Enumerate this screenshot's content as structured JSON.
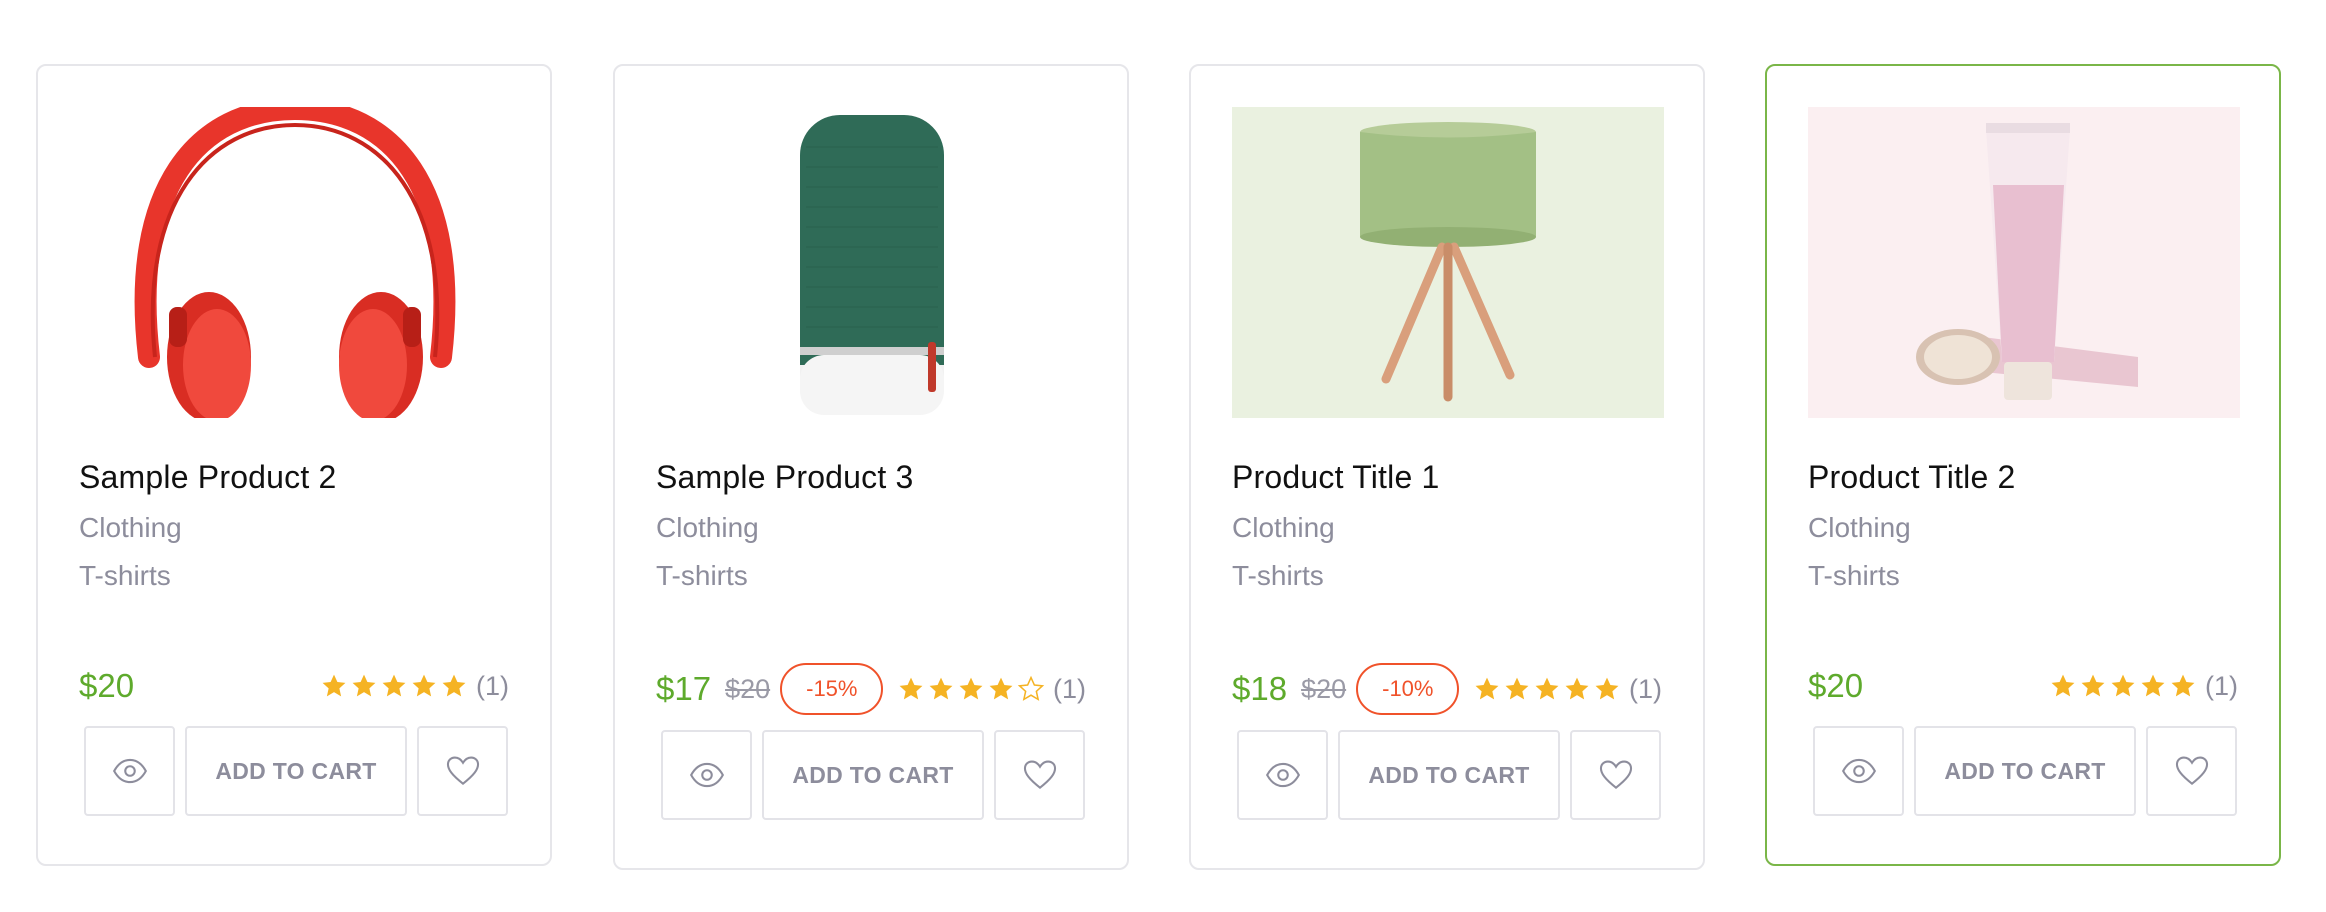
{
  "products": [
    {
      "title": "Sample Product 2",
      "categories": [
        "Clothing",
        "T-shirts"
      ],
      "price": "$20",
      "old_price": "",
      "discount": "",
      "rating": 5,
      "rating_count": "(1)",
      "image_icon": "headphones-image",
      "actions": {
        "quick_view_icon": "eye-icon",
        "cart_label": "ADD TO CART",
        "wishlist_icon": "heart-icon"
      }
    },
    {
      "title": "Sample Product 3",
      "categories": [
        "Clothing",
        "T-shirts"
      ],
      "price": "$17",
      "old_price": "$20",
      "discount": "-15%",
      "rating": 4,
      "rating_count": "(1)",
      "image_icon": "speaker-image",
      "actions": {
        "quick_view_icon": "eye-icon",
        "cart_label": "ADD TO CART",
        "wishlist_icon": "heart-icon"
      }
    },
    {
      "title": "Product Title 1",
      "categories": [
        "Clothing",
        "T-shirts"
      ],
      "price": "$18",
      "old_price": "$20",
      "discount": "-10%",
      "rating": 5,
      "rating_count": "(1)",
      "image_icon": "lamp-image",
      "actions": {
        "quick_view_icon": "eye-icon",
        "cart_label": "ADD TO CART",
        "wishlist_icon": "heart-icon"
      }
    },
    {
      "title": "Product Title 2",
      "categories": [
        "Clothing",
        "T-shirts"
      ],
      "price": "$20",
      "old_price": "",
      "discount": "",
      "rating": 5,
      "rating_count": "(1)",
      "image_icon": "cosmetic-tube-image",
      "actions": {
        "quick_view_icon": "eye-icon",
        "cart_label": "ADD TO CART",
        "wishlist_icon": "heart-icon"
      }
    }
  ],
  "colors": {
    "price": "#5eaa2c",
    "discount": "#f0522a",
    "star": "#f5b323",
    "active_border": "#7ab648",
    "muted_text": "#8d8d9c"
  }
}
